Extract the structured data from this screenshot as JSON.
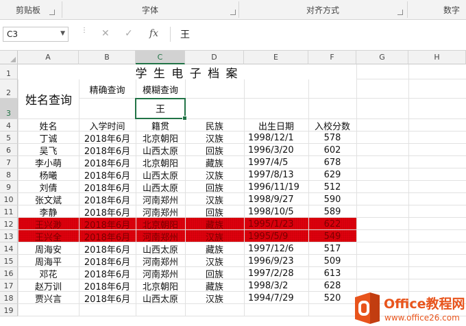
{
  "ribbon": {
    "groups": [
      "剪贴板",
      "字体",
      "对齐方式",
      "数字"
    ]
  },
  "formula_bar": {
    "name_box": "C3",
    "cancel": "✕",
    "enter": "✓",
    "fx": "fx",
    "content": "王"
  },
  "columns": [
    "A",
    "B",
    "C",
    "D",
    "E",
    "F",
    "G",
    "H"
  ],
  "rows": [
    "1",
    "2",
    "3",
    "4",
    "5",
    "6",
    "7",
    "8",
    "9",
    "10",
    "11",
    "12",
    "13",
    "14",
    "15",
    "16",
    "17",
    "18",
    "19"
  ],
  "sheet": {
    "title": "学 生 电 子 档 案",
    "lookup_label": "姓名查询",
    "exact_query": "精确查询",
    "fuzzy_query": "模糊查询",
    "query_value": "王",
    "headers": [
      "姓名",
      "入学时间",
      "籍贯",
      "民族",
      "出生日期",
      "入校分数"
    ],
    "records": [
      [
        "丁诚",
        "2018年6月",
        "北京朝阳",
        "汉族",
        "1998/12/1",
        "578"
      ],
      [
        "吴飞",
        "2018年6月",
        "山西太原",
        "回族",
        "1996/3/20",
        "602"
      ],
      [
        "李小萌",
        "2018年6月",
        "北京朝阳",
        "藏族",
        "1997/4/5",
        "678"
      ],
      [
        "杨曦",
        "2018年6月",
        "山西太原",
        "汉族",
        "1997/8/13",
        "629"
      ],
      [
        "刘倩",
        "2018年6月",
        "山西太原",
        "回族",
        "1996/11/19",
        "512"
      ],
      [
        "张文斌",
        "2018年6月",
        "河南郑州",
        "汉族",
        "1998/9/27",
        "590"
      ],
      [
        "李静",
        "2018年6月",
        "河南郑州",
        "回族",
        "1998/10/5",
        "589"
      ],
      [
        "王兴渺",
        "2018年6月",
        "北京朝阳",
        "藏族",
        "1995/1/23",
        "622"
      ],
      [
        "王兴全",
        "2018年6月",
        "河南郑州",
        "汉族",
        "1995/5/9",
        "549"
      ],
      [
        "周海安",
        "2018年6月",
        "山西太原",
        "藏族",
        "1997/12/6",
        "517"
      ],
      [
        "周海平",
        "2018年6月",
        "河南郑州",
        "汉族",
        "1996/9/23",
        "509"
      ],
      [
        "邓花",
        "2018年6月",
        "河南郑州",
        "回族",
        "1997/2/28",
        "613"
      ],
      [
        "赵万训",
        "2018年6月",
        "北京朝阳",
        "藏族",
        "1998/3/2",
        "628"
      ],
      [
        "贾兴言",
        "2018年6月",
        "山西太原",
        "汉族",
        "1994/7/29",
        "520"
      ]
    ],
    "highlight_color": "#e3000f"
  },
  "watermark": {
    "brand": "Office教程网",
    "url": "www.office26.com",
    "accent": "#e8541c"
  }
}
